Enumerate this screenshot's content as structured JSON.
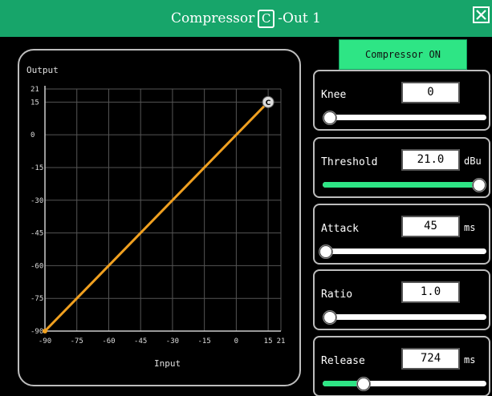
{
  "window": {
    "title_prefix": "Compressor",
    "title_badge": "C",
    "title_suffix": "-Out 1",
    "close_icon": "close-x-icon",
    "accent_color": "#17a56a"
  },
  "compressor_toggle": {
    "label": "Compressor ON",
    "state": "on",
    "color": "#2ee585"
  },
  "graph": {
    "ylabel": "Output",
    "xlabel": "Input",
    "y_ticks": [
      "21",
      "15",
      "0",
      "-15",
      "-30",
      "-45",
      "-60",
      "-75",
      "-90"
    ],
    "x_ticks": [
      "-90",
      "-75",
      "-60",
      "-45",
      "-30",
      "-15",
      "0",
      "15",
      "21"
    ],
    "handle_label": "C",
    "curve_color": "#f0a020"
  },
  "controls": [
    {
      "id": "knee",
      "label": "Knee",
      "value": "0",
      "unit": "",
      "level": 0.0
    },
    {
      "id": "threshold",
      "label": "Threshold",
      "value": "21.0",
      "unit": "dBu",
      "level": 1.0
    },
    {
      "id": "attack",
      "label": "Attack",
      "value": "45",
      "unit": "ms",
      "level": 0.02
    },
    {
      "id": "ratio",
      "label": "Ratio",
      "value": "1.0",
      "unit": "",
      "level": 0.0
    },
    {
      "id": "release",
      "label": "Release",
      "value": "724",
      "unit": "ms",
      "level": 0.25
    }
  ],
  "chart_data": {
    "type": "line",
    "xlabel": "Input",
    "ylabel": "Output",
    "xlim": [
      -90,
      21
    ],
    "ylim": [
      -90,
      21
    ],
    "x_tick_values": [
      -90,
      -75,
      -60,
      -45,
      -30,
      -15,
      0,
      15,
      21
    ],
    "y_tick_values": [
      21,
      15,
      0,
      -15,
      -30,
      -45,
      -60,
      -75,
      -90
    ],
    "series": [
      {
        "x": [
          -90,
          15
        ],
        "y": [
          -90,
          15
        ]
      }
    ],
    "grid": true
  }
}
